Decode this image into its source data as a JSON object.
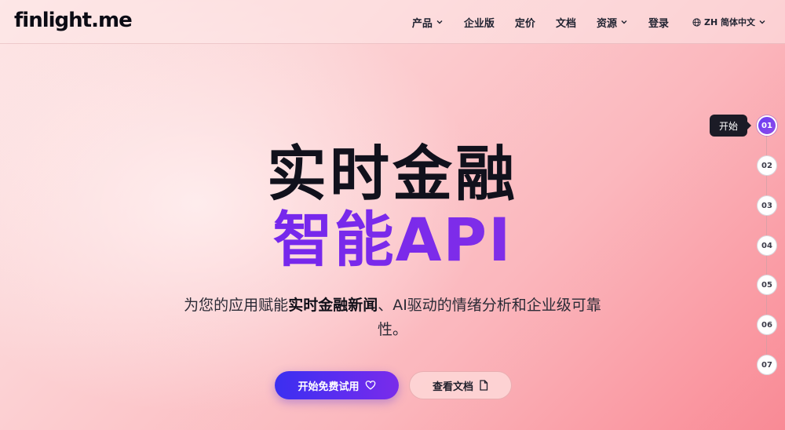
{
  "header": {
    "logo": "finlight.me",
    "nav": [
      {
        "label": "产品",
        "dropdown": true
      },
      {
        "label": "企业版",
        "dropdown": false
      },
      {
        "label": "定价",
        "dropdown": false
      },
      {
        "label": "文档",
        "dropdown": false
      },
      {
        "label": "资源",
        "dropdown": true
      },
      {
        "label": "登录",
        "dropdown": false
      }
    ],
    "language": "ZH 简体中文"
  },
  "hero": {
    "title_line1": "实时金融",
    "title_line2": "智能API",
    "subtitle_prefix": "为您的应用赋能",
    "subtitle_bold": "实时金融新闻",
    "subtitle_suffix": "、AI驱动的情绪分析和企业级可靠性。"
  },
  "buttons": {
    "primary": "开始免费试用",
    "secondary": "查看文档"
  },
  "steps": {
    "items": [
      "01",
      "02",
      "03",
      "04",
      "05",
      "06",
      "07"
    ],
    "active_index": 0,
    "tooltip": "开始"
  },
  "colors": {
    "accent": "#6b21f0",
    "primary_button": "#4a2ef0"
  },
  "icons": {
    "dropdown": "chevron-down-icon",
    "language": "globe-icon",
    "primary_button": "heart-icon",
    "secondary_button": "document-icon"
  }
}
